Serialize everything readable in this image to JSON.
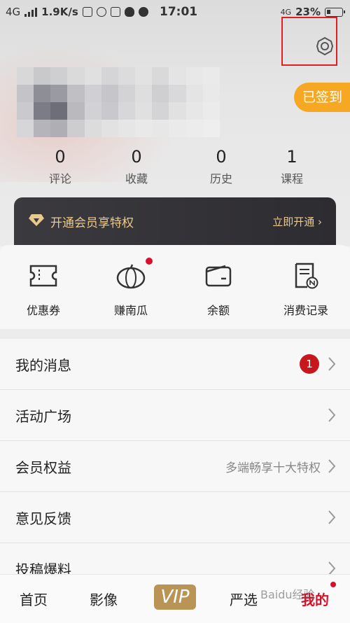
{
  "status_bar": {
    "network_left": "4G",
    "speed": "1.9K/s",
    "time": "17:01",
    "network_right": "4G",
    "battery": "23%"
  },
  "header": {
    "signin_label": "已签到",
    "settings_icon": "gear-icon"
  },
  "stats": [
    {
      "value": "0",
      "label": "评论"
    },
    {
      "value": "0",
      "label": "收藏"
    },
    {
      "value": "0",
      "label": "历史"
    },
    {
      "value": "1",
      "label": "课程"
    }
  ],
  "vip_banner": {
    "title": "开通会员享特权",
    "action": "立即开通"
  },
  "quick_actions": [
    {
      "label": "优惠券",
      "icon": "ticket-icon"
    },
    {
      "label": "赚南瓜",
      "icon": "pumpkin-icon",
      "has_dot": true
    },
    {
      "label": "余额",
      "icon": "wallet-icon"
    },
    {
      "label": "消费记录",
      "icon": "receipt-icon"
    }
  ],
  "menu": [
    {
      "label": "我的消息",
      "badge": "1"
    },
    {
      "label": "活动广场"
    },
    {
      "label": "会员权益",
      "detail": "多端畅享十大特权"
    },
    {
      "label": "意见反馈"
    },
    {
      "label": "投稿爆料"
    }
  ],
  "tabbar": {
    "items": [
      "首页",
      "影像",
      "VIP",
      "严选",
      "我的"
    ],
    "active": "我的"
  },
  "watermark": "Baidu经验",
  "colors": {
    "accent_red": "#d8112a",
    "signin_orange": "#f7a823",
    "vip_gold": "#e9c98e",
    "vip_tab": "#b99454"
  }
}
